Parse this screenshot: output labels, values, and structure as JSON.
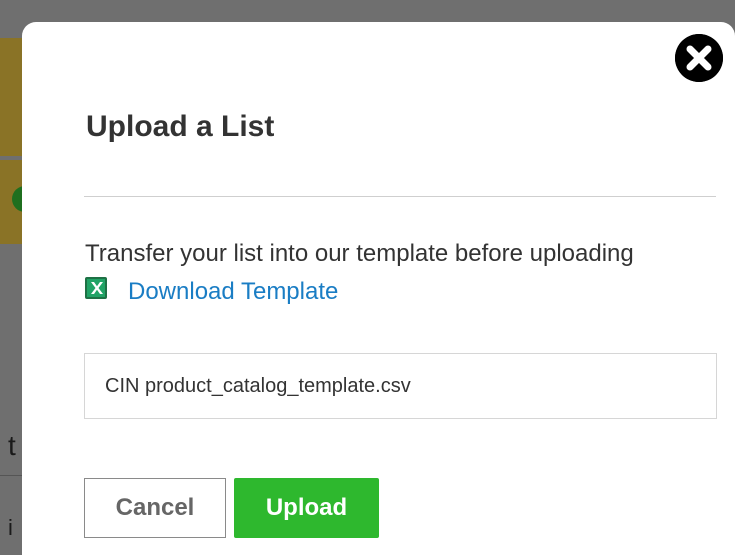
{
  "modal": {
    "title": "Upload a List",
    "instructions": "Transfer your list into our template before uploading",
    "download_link_label": "Download Template",
    "file_name": "CIN product_catalog_template.csv",
    "cancel_label": "Cancel",
    "upload_label": "Upload"
  },
  "background": {
    "partial_letters": [
      "t",
      "i"
    ]
  },
  "icons": {
    "close": "close-icon",
    "download": "excel-file-icon"
  },
  "colors": {
    "primary_button": "#2eb82e",
    "link": "#1a7dc4",
    "overlay": "#6f6f6f",
    "title_text": "#333333"
  }
}
